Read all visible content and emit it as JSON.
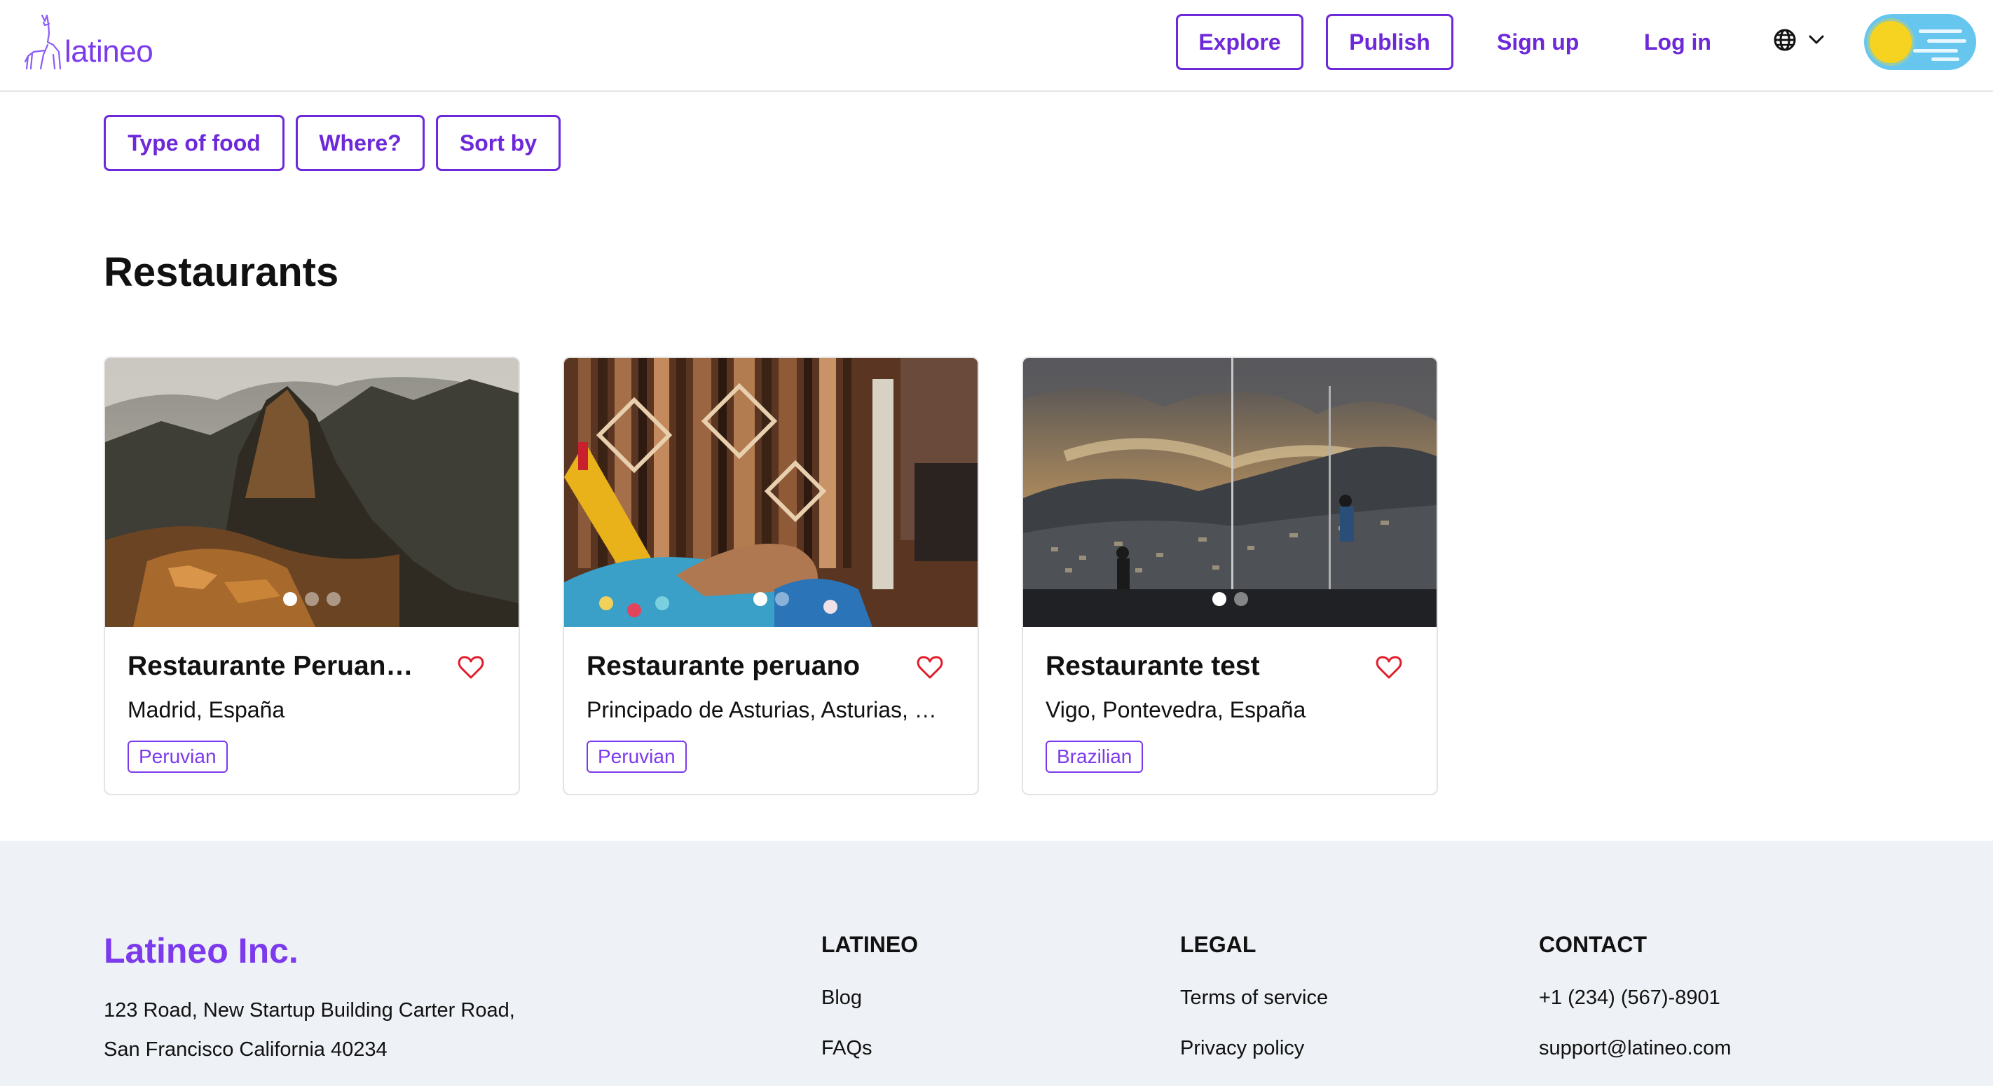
{
  "header": {
    "logo_text": "latineo",
    "nav": {
      "explore": "Explore",
      "publish": "Publish",
      "signup": "Sign up",
      "login": "Log in"
    },
    "language_icon": "globe-icon",
    "theme_toggle": "light-mode"
  },
  "filters": [
    "Type of food",
    "Where?",
    "Sort by"
  ],
  "section_title": "Restaurants",
  "restaurants": [
    {
      "title": "Restaurante Peruano en Madrid",
      "location": "Madrid, España",
      "tag": "Peruvian",
      "image_count": 3,
      "active_image": 1
    },
    {
      "title": "Restaurante peruano",
      "location": "Principado de Asturias, Asturias, España",
      "tag": "Peruvian",
      "image_count": 2,
      "active_image": 1
    },
    {
      "title": "Restaurante test",
      "location": "Vigo, Pontevedra, España",
      "tag": "Brazilian",
      "image_count": 2,
      "active_image": 1
    }
  ],
  "footer": {
    "brand": "Latineo Inc.",
    "address_line1": "123 Road, New Startup Building Carter Road,",
    "address_line2": "San Francisco California 40234",
    "columns": {
      "latineo": {
        "heading": "LATINEO",
        "links": [
          "Blog",
          "FAQs"
        ]
      },
      "legal": {
        "heading": "LEGAL",
        "links": [
          "Terms of service",
          "Privacy policy"
        ]
      },
      "contact": {
        "heading": "CONTACT",
        "links": [
          "+1 (234) (567)-8901",
          "support@latineo.com"
        ]
      }
    }
  },
  "colors": {
    "accent": "#6d28d9",
    "brand": "#7c3aed",
    "heart": "#e11d2a",
    "footer_bg": "#eef1f5",
    "toggle_bg": "#67c6ee",
    "sun": "#f5d320"
  }
}
